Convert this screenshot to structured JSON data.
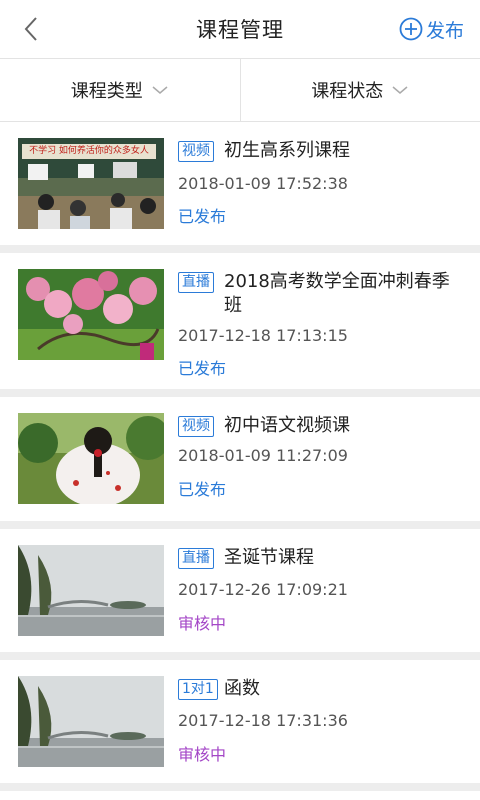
{
  "header": {
    "title": "课程管理",
    "publish_label": "发布"
  },
  "filters": [
    {
      "label": "课程类型"
    },
    {
      "label": "课程状态"
    }
  ],
  "courses": [
    {
      "tag": "视频",
      "title": "初生高系列课程",
      "time": "2018-01-09 17:52:38",
      "status": "已发布",
      "status_color": "#2b7bd8",
      "thumb_banner": "不学习  如何养活你的众多女人"
    },
    {
      "tag": "直播",
      "title": "2018高考数学全面冲刺春季班",
      "time": "2017-12-18 17:13:15",
      "status": "已发布",
      "status_color": "#2b7bd8"
    },
    {
      "tag": "视频",
      "title": "初中语文视频课",
      "time": "2018-01-09 11:27:09",
      "status": "已发布",
      "status_color": "#2b7bd8"
    },
    {
      "tag": "直播",
      "title": "圣诞节课程",
      "time": "2017-12-26 17:09:21",
      "status": "审核中",
      "status_color": "#a447c7"
    },
    {
      "tag": "1对1",
      "title": "函数",
      "time": "2017-12-18 17:31:36",
      "status": "审核中",
      "status_color": "#a447c7"
    }
  ],
  "colors": {
    "accent": "#2b7bd8",
    "pending": "#a447c7",
    "separator": "#ededed"
  }
}
